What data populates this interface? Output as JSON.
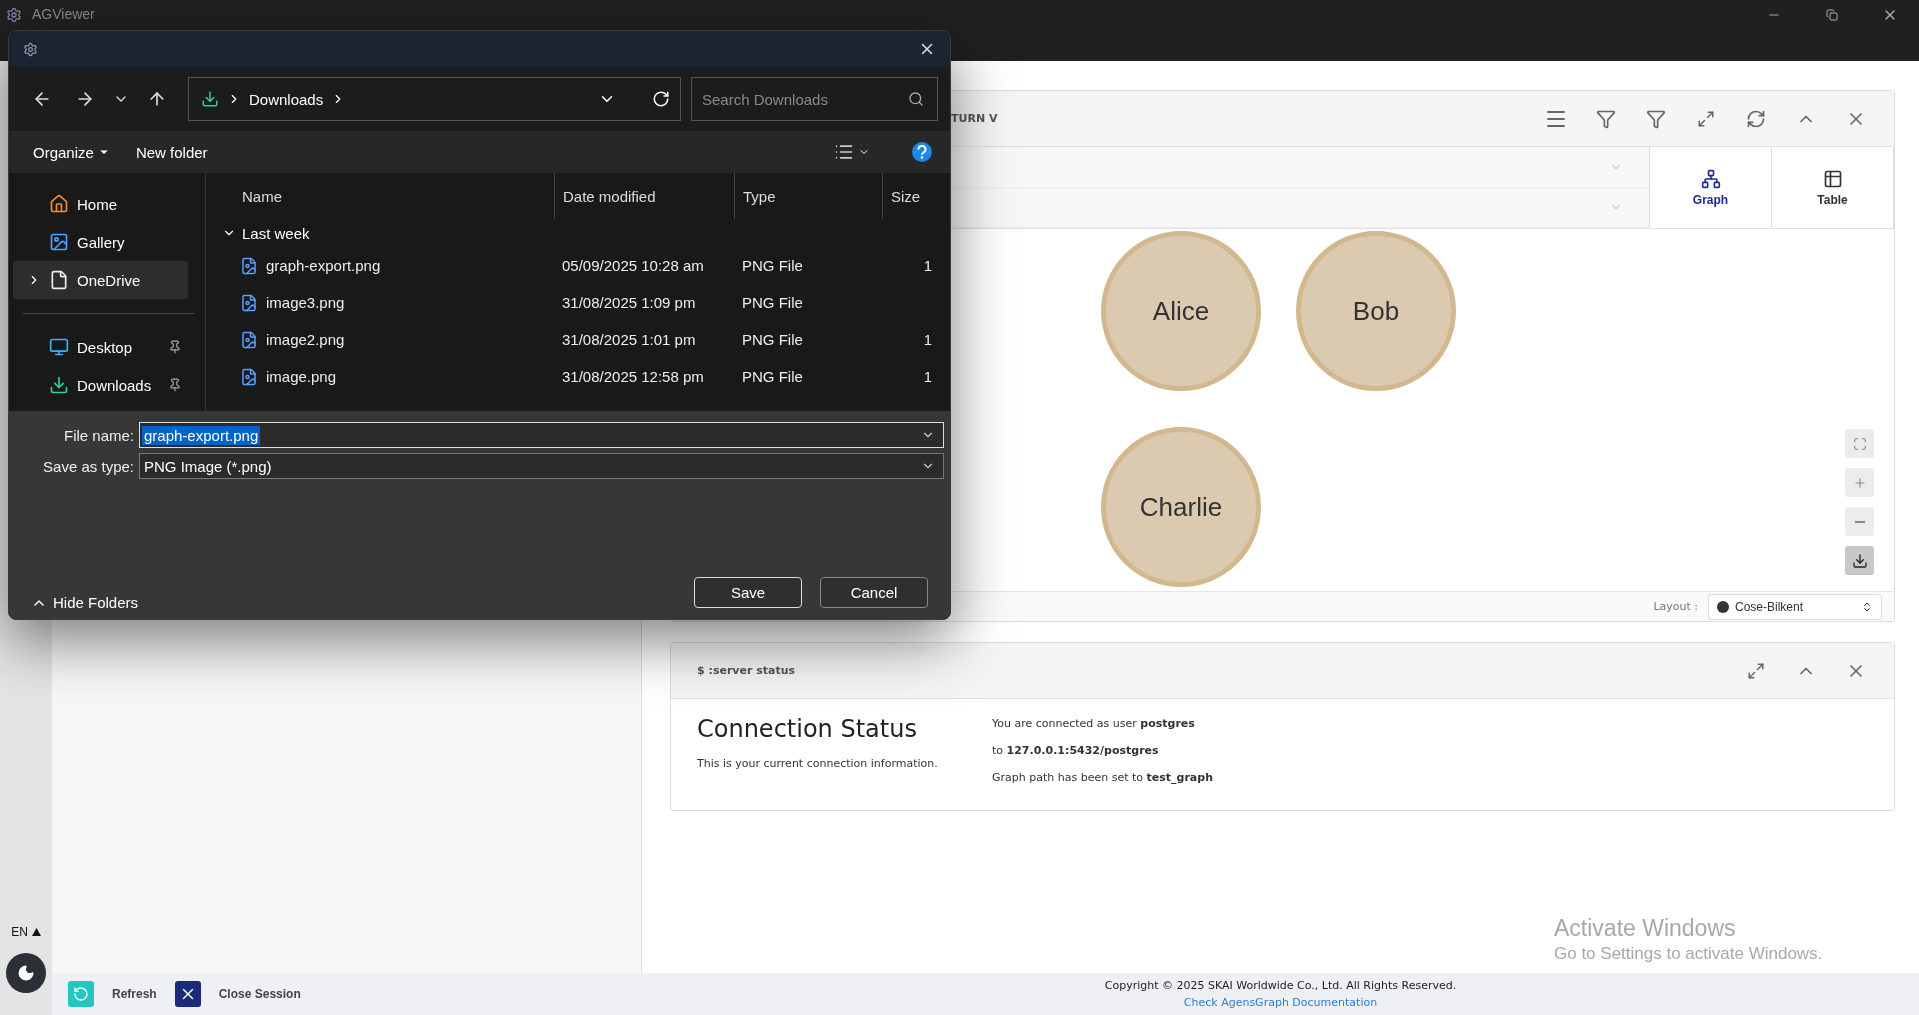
{
  "app": {
    "title": "AGViewer"
  },
  "rail": {
    "language": "EN"
  },
  "query_panel": {
    "header_text": "TURN V",
    "view_tabs": [
      {
        "label": "Graph",
        "kind": "graph",
        "selected": true
      },
      {
        "label": "Table",
        "kind": "table",
        "selected": false
      }
    ],
    "nodes": [
      {
        "label": "Alice"
      },
      {
        "label": "Bob"
      },
      {
        "label": "Charlie"
      }
    ],
    "layout_label": "Layout :",
    "layout_value": "Cose-Bilkent"
  },
  "status_panel": {
    "title": "$ :server status",
    "heading": "Connection Status",
    "subtitle": "This is your current connection information.",
    "lines": [
      "You are connected as user **postgres**",
      "to **127.0.0.1:5432/postgres**",
      "Graph path has been set to **test_graph**"
    ]
  },
  "actions": [
    {
      "label": "Refresh",
      "kind": "refresh"
    },
    {
      "label": "Close Session",
      "kind": "close"
    }
  ],
  "footer": {
    "copyright": "Copyright © 2025 SKAI Worldwide Co., Ltd. All Rights Reserved.",
    "link": "Check AgensGraph Documentation"
  },
  "activation_notice": {
    "title": "Activate Windows",
    "subtitle": "Go to Settings to activate Windows."
  },
  "dialog": {
    "address": "Downloads",
    "search_placeholder": "Search Downloads",
    "commands": [
      "Organize",
      "New folder"
    ],
    "nav_sections": [
      {
        "items": [
          {
            "label": "Home",
            "kind": "home",
            "selected": false,
            "expandable": false,
            "pinned": false
          },
          {
            "label": "Gallery",
            "kind": "gallery",
            "selected": false,
            "expandable": false,
            "pinned": false
          },
          {
            "label": "OneDrive",
            "kind": "document",
            "selected": true,
            "expandable": true,
            "pinned": false
          }
        ]
      },
      {
        "items": [
          {
            "label": "Desktop",
            "kind": "desktop",
            "selected": false,
            "expandable": false,
            "pinned": true
          },
          {
            "label": "Downloads",
            "kind": "download",
            "selected": false,
            "expandable": false,
            "pinned": true
          }
        ]
      }
    ],
    "columns": [
      "Name",
      "Date modified",
      "Type",
      "Size"
    ],
    "group": "Last week",
    "files": [
      {
        "name": "graph-export.png",
        "date": "05/09/2025 10:28 am",
        "type": "PNG File",
        "size": "1"
      },
      {
        "name": "image3.png",
        "date": "31/08/2025 1:09 pm",
        "type": "PNG File"
      },
      {
        "name": "image2.png",
        "date": "31/08/2025 1:01 pm",
        "type": "PNG File",
        "size": "1"
      },
      {
        "name": "image.png",
        "date": "31/08/2025 12:58 pm",
        "type": "PNG File",
        "size": "1"
      }
    ],
    "file_name_label": "File name:",
    "file_name": {
      "value": "graph-export.png",
      "selected": true
    },
    "save_type_label": "Save as type:",
    "save_type": "PNG Image (*.png)",
    "hide_folders": "Hide Folders",
    "buttons": [
      "Save",
      "Cancel"
    ]
  }
}
